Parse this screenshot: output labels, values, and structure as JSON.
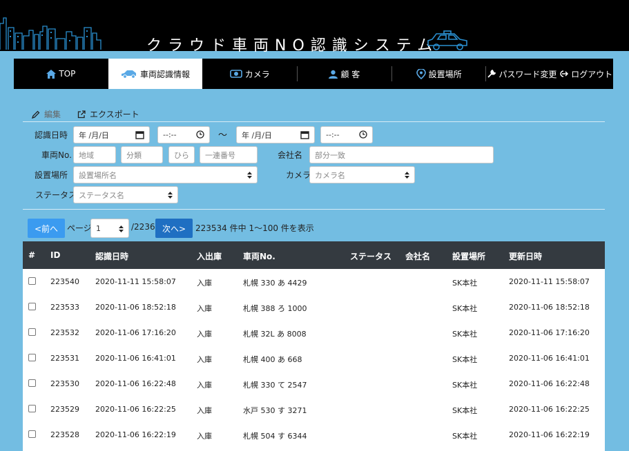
{
  "header": {
    "title": "クラウド車両NO認識システム"
  },
  "nav": [
    {
      "label": "TOP",
      "icon": "home-icon"
    },
    {
      "label": "車両認識情報",
      "icon": "car-icon"
    },
    {
      "label": "カメラ",
      "icon": "camera-icon"
    },
    {
      "label": "顧 客",
      "icon": "user-icon"
    },
    {
      "label": "設置場所",
      "icon": "location-pin-icon"
    },
    {
      "label": "パスワード変更",
      "icon": "wrench-icon"
    },
    {
      "label": "ログアウト",
      "icon": "logout-icon"
    }
  ],
  "toolbar": {
    "edit": "編集",
    "export": "エクスポート"
  },
  "filters": {
    "date_label": "認識日時",
    "date_from": "年 /月/日",
    "time_from": "--:--",
    "tilde": "〜",
    "date_to": "年 /月/日",
    "time_to": "--:--",
    "vehicle_label": "車両No.",
    "area_ph": "地域",
    "class_ph": "分類",
    "hira_ph": "ひら",
    "serial_ph": "一連番号",
    "company_label": "会社名",
    "company_ph": "部分一致",
    "place_label": "設置場所",
    "place_select": "設置場所名",
    "camera_label": "カメラ",
    "camera_select": "カメラ名",
    "status_label": "ステータス",
    "status_select": "ステータス名"
  },
  "pager": {
    "prev": "<前へ",
    "page_label": "ページ",
    "page_value": "1",
    "total_pages": "/2236",
    "next": "次へ>",
    "summary": "223534  件中  1〜100  件を表示"
  },
  "table": {
    "headers": [
      "#",
      "ID",
      "認識日時",
      "入出庫",
      "車両No.",
      "ステータス",
      "会社名",
      "設置場所",
      "更新日時"
    ],
    "rows": [
      {
        "id": "223540",
        "time": "2020-11-11 15:58:07",
        "io": "入庫",
        "plate": "札幌 330 あ 4429",
        "status": "",
        "company": "",
        "place": "SK本社",
        "updated": "2020-11-11 15:58:07"
      },
      {
        "id": "223533",
        "time": "2020-11-06 18:52:18",
        "io": "入庫",
        "plate": "札幌 388 ろ 1000",
        "status": "",
        "company": "",
        "place": "SK本社",
        "updated": "2020-11-06 18:52:18"
      },
      {
        "id": "223532",
        "time": "2020-11-06 17:16:20",
        "io": "入庫",
        "plate": "札幌 32L あ 8008",
        "status": "",
        "company": "",
        "place": "SK本社",
        "updated": "2020-11-06 17:16:20"
      },
      {
        "id": "223531",
        "time": "2020-11-06 16:41:01",
        "io": "入庫",
        "plate": "札幌 400 あ 668",
        "status": "",
        "company": "",
        "place": "SK本社",
        "updated": "2020-11-06 16:41:01"
      },
      {
        "id": "223530",
        "time": "2020-11-06 16:22:48",
        "io": "入庫",
        "plate": "札幌 330 て 2547",
        "status": "",
        "company": "",
        "place": "SK本社",
        "updated": "2020-11-06 16:22:48"
      },
      {
        "id": "223529",
        "time": "2020-11-06 16:22:25",
        "io": "入庫",
        "plate": "水戸 530 す 3271",
        "status": "",
        "company": "",
        "place": "SK本社",
        "updated": "2020-11-06 16:22:25"
      },
      {
        "id": "223528",
        "time": "2020-11-06 16:22:19",
        "io": "入庫",
        "plate": "札幌 504 す 6344",
        "status": "",
        "company": "",
        "place": "SK本社",
        "updated": "2020-11-06 16:22:19"
      }
    ]
  },
  "colors": {
    "background": "#73bde2",
    "nav": "#000000",
    "prev_button": "#3b9bf0",
    "next_button": "#1f6fc2",
    "table_header": "#343a40"
  }
}
